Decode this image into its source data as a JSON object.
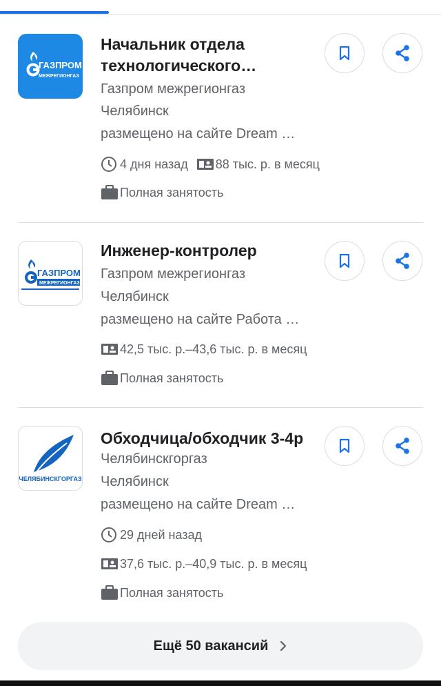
{
  "jobs": [
    {
      "title": "Начальник отдела технологического…",
      "company": "Газпром межрегионгаз",
      "city": "Челябинск",
      "source": "размещено на сайте Dream …",
      "posted": "4 дня назад",
      "salary": "88 тыс. р. в месяц",
      "employment": "Полная занятость",
      "logo": {
        "text1": "ГАЗПРОМ",
        "text2": "МЕЖРЕГИОНГАЗ",
        "style": "white-on-blue"
      }
    },
    {
      "title": "Инженер-контролер",
      "company": "Газпром межрегионгаз",
      "city": "Челябинск",
      "source": "размещено на сайте Работа …",
      "salary": "42,5 тыс. р.–43,6 тыс. р. в месяц",
      "employment": "Полная занятость",
      "logo": {
        "text1": "ГАЗПРОМ",
        "text2": "МЕЖРЕГИОНГАЗ",
        "style": "blue-on-white"
      }
    },
    {
      "title": "Обходчица/обходчик 3-4р",
      "company": "Челябинскгоргаз",
      "city": "Челябинск",
      "source": "размещено на сайте Dream …",
      "posted": "29 дней назад",
      "salary": "37,6 тыс. р.–40,9 тыс. р. в месяц",
      "employment": "Полная занятость",
      "logo": {
        "text1": "ЧЕЛЯБИНСКГОРГАЗ",
        "style": "leaf"
      }
    }
  ],
  "more_button": {
    "label": "Ещё 50 вакансий"
  },
  "icons": {
    "save": "bookmark-icon",
    "share": "share-icon",
    "posted": "clock-icon",
    "salary": "salary-icon",
    "employment": "briefcase-icon",
    "more": "chevron-right-icon"
  },
  "colors": {
    "accent": "#1a73e8",
    "logo_blue": "#1e88e5",
    "text": "#202124",
    "secondary": "#5f6368"
  }
}
